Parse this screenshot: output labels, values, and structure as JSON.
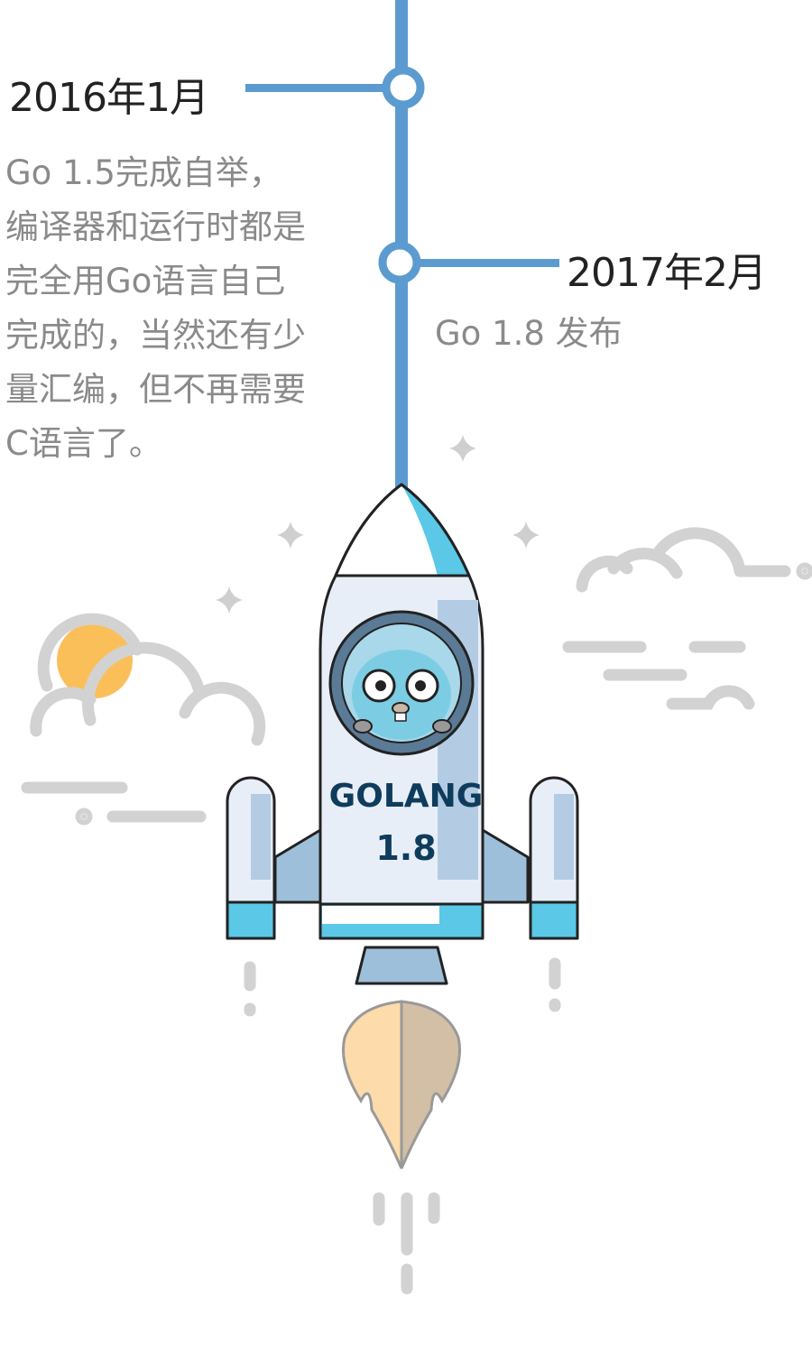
{
  "timeline": {
    "events": [
      {
        "date": "2016年1月",
        "description_lines": [
          "Go 1.5完成自举，",
          "编译器和运行时都是",
          "完全用Go语言自己",
          "完成的，当然还有少",
          "量汇编，但不再需要",
          "C语言了。"
        ]
      },
      {
        "date": "2017年2月",
        "description_lines": [
          "Go 1.8 发布"
        ]
      }
    ],
    "line_color": "#5b9bd0"
  },
  "rocket": {
    "label": "GOLANG",
    "version": "1.8",
    "colors": {
      "accent": "#5ac8e6",
      "body": "#e8eef8",
      "shade": "#b3cce3",
      "text": "#0f3c5c"
    }
  }
}
